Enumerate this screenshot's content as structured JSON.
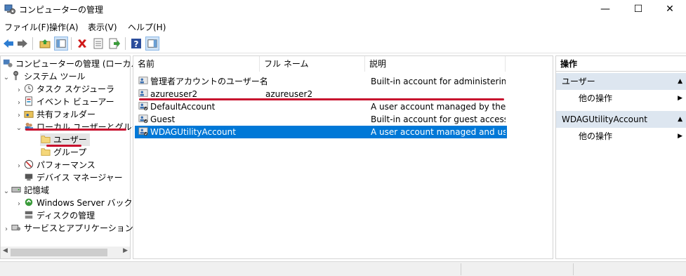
{
  "window": {
    "title": "コンピューターの管理",
    "minimize_glyph": "—",
    "maximize_glyph": "☐",
    "close_glyph": "✕"
  },
  "menu": [
    "ファイル(F)",
    "操作(A)",
    "表示(V)",
    "ヘルプ(H)"
  ],
  "toolbar": {
    "icons": [
      "back-arrow-icon",
      "forward-arrow-icon",
      "up-folder-icon",
      "show-hide-tree-icon",
      "delete-icon",
      "properties-icon",
      "export-list-icon",
      "help-icon",
      "show-hide-action-pane-icon"
    ]
  },
  "tree": {
    "root": "コンピューターの管理 (ローカル)",
    "system_tools": "システム ツール",
    "task_scheduler": "タスク スケジューラ",
    "event_viewer": "イベント ビューアー",
    "shared_folders": "共有フォルダー",
    "local_users_groups": "ローカル ユーザーとグループ",
    "users": "ユーザー",
    "groups": "グループ",
    "performance": "パフォーマンス",
    "device_manager": "デバイス マネージャー",
    "storage": "記憶域",
    "windows_server_backup": "Windows Server バックア",
    "disk_management": "ディスクの管理",
    "services_apps": "サービスとアプリケーション"
  },
  "list": {
    "columns": [
      "名前",
      "フル ネーム",
      "説明"
    ],
    "rows": [
      {
        "name": "管理者アカウントのユーザー名",
        "full_name": "",
        "description": "Built-in account for administering..."
      },
      {
        "name": "azureuser2",
        "full_name": "azureuser2",
        "description": ""
      },
      {
        "name": "DefaultAccount",
        "full_name": "",
        "description": "A user account managed by the s..."
      },
      {
        "name": "Guest",
        "full_name": "",
        "description": "Built-in account for guest access t..."
      },
      {
        "name": "WDAGUtilityAccount",
        "full_name": "",
        "description": "A user account managed and use..."
      }
    ],
    "selected_row": "WDAGUtilityAccount"
  },
  "actions": {
    "title": "操作",
    "section1": "ユーザー",
    "section1_item": "他の操作",
    "section2": "WDAGUtilityAccount",
    "section2_item": "他の操作"
  },
  "colors": {
    "selection": "#0078d7",
    "annotation_red": "#c8102e",
    "action_header": "#dde6f0"
  }
}
